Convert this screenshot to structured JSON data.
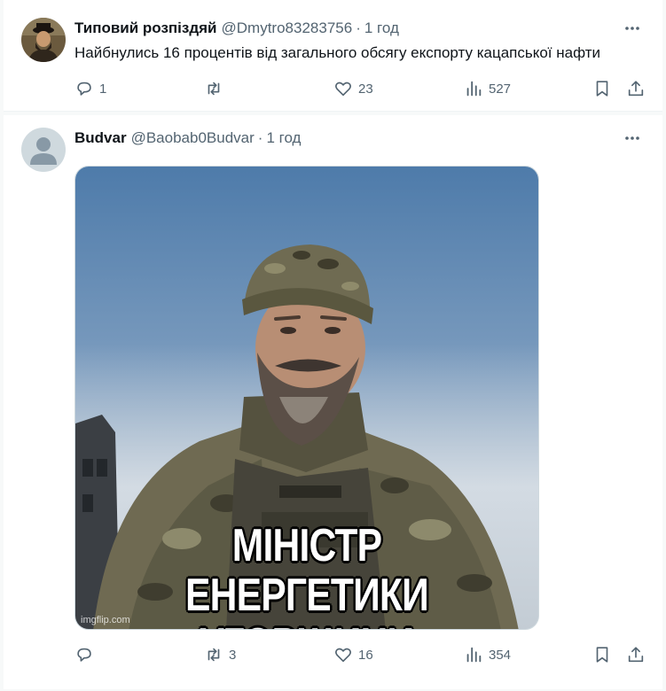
{
  "posts": [
    {
      "author_name": "Типовий розпіздяй",
      "handle": "@Dmytro83283756",
      "separator": "·",
      "time": "1 год",
      "text": "Найбнулись 16 процентів від загального обсягу експорту кацапської нафти",
      "replies": "1",
      "reposts": "",
      "likes": "23",
      "views": "527"
    },
    {
      "author_name": "Budvar",
      "handle": "@Baobab0Budvar",
      "separator": "·",
      "time": "1 год",
      "media": {
        "caption_line1": "МІНІСТР",
        "caption_line2": "ЕНЕРГЕТИКИ УГОРЩИНИ",
        "watermark": "imgflip.com"
      },
      "replies": "",
      "reposts": "3",
      "likes": "16",
      "views": "354"
    }
  ],
  "icons": {
    "more": "more-horizontal-icon",
    "reply": "reply-icon",
    "repost": "repost-icon",
    "like": "heart-icon",
    "views": "views-bar-chart-icon",
    "bookmark": "bookmark-icon",
    "share": "share-icon"
  },
  "colors": {
    "text_primary": "#0f1419",
    "text_secondary": "#536471",
    "background": "#f7f9f9",
    "card": "#ffffff"
  }
}
